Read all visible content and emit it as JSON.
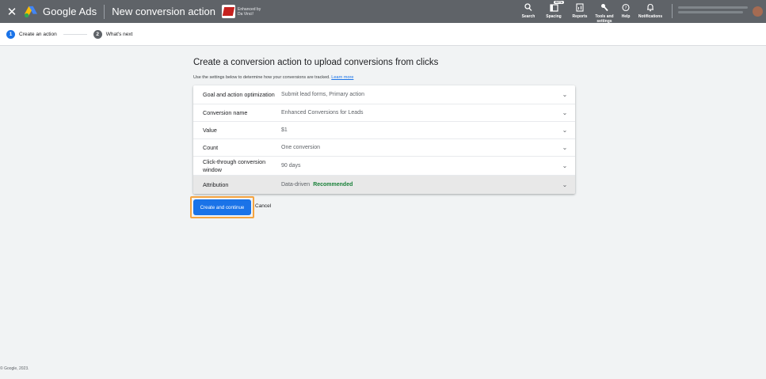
{
  "topbar": {
    "close_glyph": "✕",
    "brand": "Google Ads",
    "title": "New conversion action",
    "partner_line1": "Enhanced by",
    "partner_line2": "Da Vinci!",
    "tools": [
      {
        "label": "Search",
        "icon": "search-icon",
        "glyph": "⚲"
      },
      {
        "label": "Spacing",
        "icon": "spacing-icon",
        "glyph": "▥",
        "badge": "BETA"
      },
      {
        "label": "Reports",
        "icon": "reports-icon",
        "glyph": "▤"
      },
      {
        "label": "Tools and settings",
        "icon": "wrench-icon",
        "glyph": "⚒"
      },
      {
        "label": "Help",
        "icon": "help-icon",
        "glyph": "?"
      },
      {
        "label": "Notifications",
        "icon": "bell-icon",
        "glyph": "♢"
      }
    ]
  },
  "stepper": {
    "steps": [
      {
        "num": "1",
        "label": "Create an action"
      },
      {
        "num": "2",
        "label": "What's next"
      }
    ]
  },
  "main": {
    "title": "Create a conversion action to upload conversions from clicks",
    "subtitle": "Use the settings below to determine how your conversions are tracked.",
    "learn_more": "Learn more",
    "rows": [
      {
        "label": "Goal and action optimization",
        "value": "Submit lead forms, Primary action"
      },
      {
        "label": "Conversion name",
        "value": "Enhanced Conversions for Leads"
      },
      {
        "label": "Value",
        "value": "$1"
      },
      {
        "label": "Count",
        "value": "One conversion"
      },
      {
        "label": "Click-through conversion window",
        "value": "90 days"
      },
      {
        "label": "Attribution",
        "value": "Data-driven",
        "badge": "Recommended"
      }
    ],
    "chevron": "⌄"
  },
  "actions": {
    "primary": "Create and continue",
    "cancel": "Cancel"
  },
  "footer": {
    "copyright": "© Google, 2023."
  },
  "colors": {
    "topbar": "#5f6368",
    "accent": "#1a73e8",
    "focus_outline": "#f5a441",
    "recommended": "#188038"
  }
}
